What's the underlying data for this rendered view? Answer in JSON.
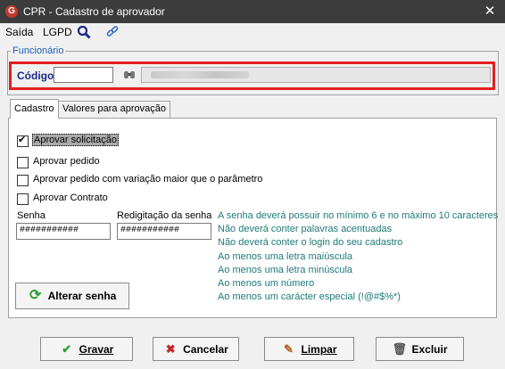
{
  "window": {
    "title": "CPR - Cadastro de aprovador",
    "close_symbol": "✕",
    "app_icon_letter": "G"
  },
  "menu": {
    "saida": "Saída",
    "lgpd": "LGPD",
    "search_icon": "magnifier-icon",
    "link_icon": "link-icon"
  },
  "funcionario": {
    "legend": "Funcionário",
    "codigo_label": "Código",
    "codigo_value": "",
    "name_value": ""
  },
  "tabs": [
    {
      "label": "Cadastro",
      "active": true
    },
    {
      "label": "Valores para aprovação",
      "active": false
    }
  ],
  "checkboxes": [
    {
      "label": "Aprovar solicitação",
      "checked": true
    },
    {
      "label": "Aprovar pedido",
      "checked": false
    },
    {
      "label": "Aprovar pedido com variação maior que o parâmetro",
      "checked": false
    },
    {
      "label": "Aprovar Contrato",
      "checked": false
    }
  ],
  "password": {
    "senha_label": "Senha",
    "senha_value": "###########",
    "redigitacao_label": "Redigitação da senha",
    "redigitacao_value": "###########"
  },
  "rules": [
    "A senha deverá possuir no mínimo 6 e no máximo 10 caracteres",
    "Não deverá conter palavras acentuadas",
    "Não deverá conter o login do seu cadastro",
    "Ao menos uma letra maiúscula",
    "Ao menos uma letra minúscula",
    "Ao menos um número",
    "Ao menos um carácter especial (!@#$%*)"
  ],
  "buttons": {
    "alterar": "Alterar senha",
    "gravar": "Gravar",
    "cancelar": "Cancelar",
    "limpar": "Limpar",
    "excluir": "Excluir"
  },
  "colors": {
    "highlight": "#e02020",
    "rule_text": "#1d7a76",
    "legend_text": "#1a5fb4",
    "titlebar": "#3c3c3c"
  }
}
